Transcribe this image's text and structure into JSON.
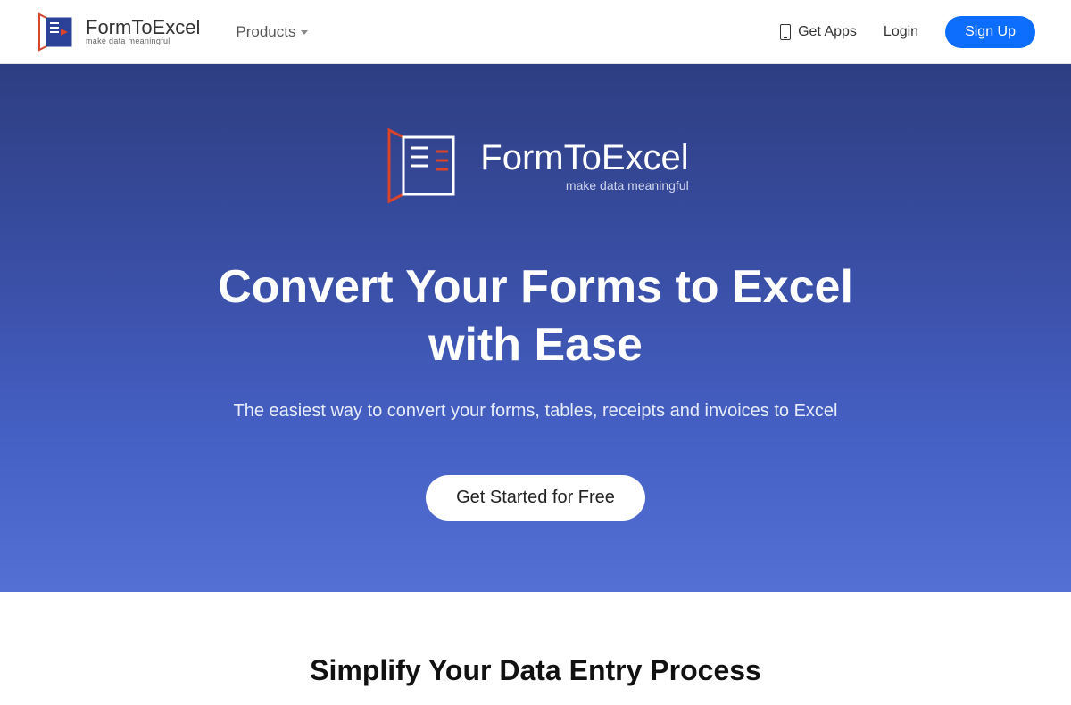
{
  "brand": {
    "title": "FormToExcel",
    "tagline": "make data meaningful"
  },
  "nav": {
    "products": "Products",
    "get_apps": "Get Apps",
    "login": "Login",
    "signup": "Sign Up"
  },
  "hero": {
    "logo_title": "FormToExcel",
    "logo_tagline": "make data meaningful",
    "heading": "Convert Your Forms to Excel with Ease",
    "subheading": "The easiest way to convert your forms, tables, receipts and invoices to Excel",
    "cta": "Get Started for Free"
  },
  "section2": {
    "heading": "Simplify Your Data Entry Process"
  },
  "colors": {
    "primary": "#0d6efd",
    "hero_start": "#2e3e82",
    "hero_end": "#5470d4"
  }
}
